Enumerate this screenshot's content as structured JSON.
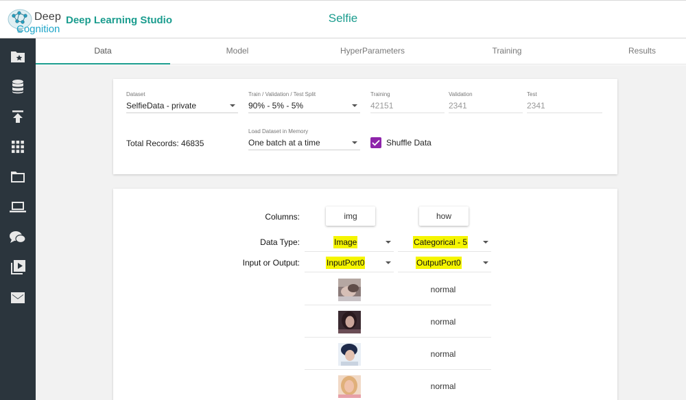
{
  "header": {
    "logo_word1": "Deep",
    "logo_word2": "Cognition",
    "app_name": "Deep Learning Studio",
    "project_name": "Selfie"
  },
  "sidebar": {
    "items": [
      {
        "icon": "star-folder-icon"
      },
      {
        "icon": "database-icon"
      },
      {
        "icon": "upload-icon"
      },
      {
        "icon": "grid-icon"
      },
      {
        "icon": "folder-icon"
      },
      {
        "icon": "laptop-icon"
      },
      {
        "icon": "chat-icon"
      },
      {
        "icon": "video-library-icon"
      },
      {
        "icon": "mail-icon"
      }
    ]
  },
  "tabs": [
    {
      "label": "Data",
      "active": true
    },
    {
      "label": "Model"
    },
    {
      "label": "HyperParameters"
    },
    {
      "label": "Training"
    },
    {
      "label": "Results"
    }
  ],
  "dataset": {
    "dataset_label": "Dataset",
    "dataset_value": "SelfieData - private",
    "split_label": "Train / Validation / Test Split",
    "split_value": "90% - 5% - 5%",
    "training_label": "Training",
    "training_value": "42151",
    "validation_label": "Validation",
    "validation_value": "2341",
    "test_label": "Test",
    "test_value": "2341",
    "total_records": "Total Records: 46835",
    "load_label": "Load Dataset in Memory",
    "load_value": "One batch at a time",
    "shuffle_label": "Shuffle Data",
    "shuffle_checked": true
  },
  "columns_table": {
    "columns_label": "Columns:",
    "datatype_label": "Data Type:",
    "io_label": "Input or Output:",
    "columns": [
      {
        "name": "img",
        "data_type": "Image",
        "io": "InputPort0"
      },
      {
        "name": "how",
        "data_type": "Categorical - 5",
        "io": "OutputPort0"
      }
    ],
    "rows": [
      {
        "img": "selfie-thumbnail",
        "how": "normal"
      },
      {
        "img": "selfie-thumbnail",
        "how": "normal"
      },
      {
        "img": "selfie-thumbnail",
        "how": "normal"
      },
      {
        "img": "selfie-thumbnail",
        "how": "normal"
      }
    ]
  },
  "colors": {
    "accent": "#1a9c8e",
    "sidebar_bg": "#2b353d",
    "highlight": "#f5f500",
    "checkbox": "#8e24aa"
  }
}
